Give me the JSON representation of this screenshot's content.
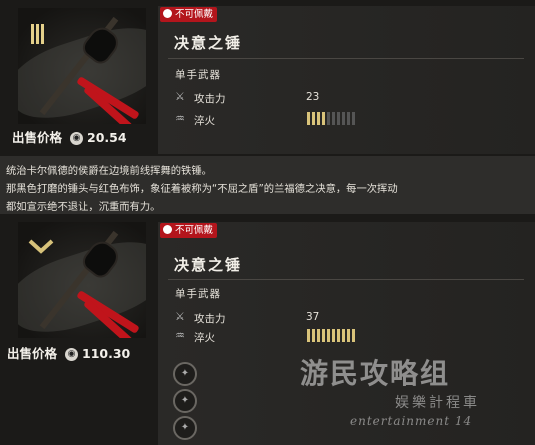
{
  "items": [
    {
      "badge": "不可佩戴",
      "name": "决意之锤",
      "type": "单手武器",
      "attack_label": "攻击力",
      "attack_value": "23",
      "temper_label": "淬火",
      "temper_level": 4,
      "temper_max": 10,
      "sale_label": "出售价格",
      "sale_price": "20.54",
      "tier_marks": 3
    },
    {
      "badge": "不可佩戴",
      "name": "决意之锤",
      "type": "单手武器",
      "attack_label": "攻击力",
      "attack_value": "37",
      "temper_label": "淬火",
      "temper_level": 10,
      "temper_max": 10,
      "sale_label": "出售价格",
      "sale_price": "110.30"
    }
  ],
  "description": [
    "统治卡尔佩德的侯爵在边境前线挥舞的铁锤。",
    "那黑色打磨的锤头与红色布饰，象征着被称为“不屈之盾”的兰福德之决意，每一次挥动",
    "都如宣示绝不退让，沉重而有力。"
  ],
  "watermark": {
    "line1": "游民攻略组",
    "line2": "娱樂計程車",
    "line3": "entertainment 14"
  },
  "colors": {
    "badge_red": "#b3151c",
    "temper_on": "#d9c37a",
    "temper_off": "#555555"
  }
}
